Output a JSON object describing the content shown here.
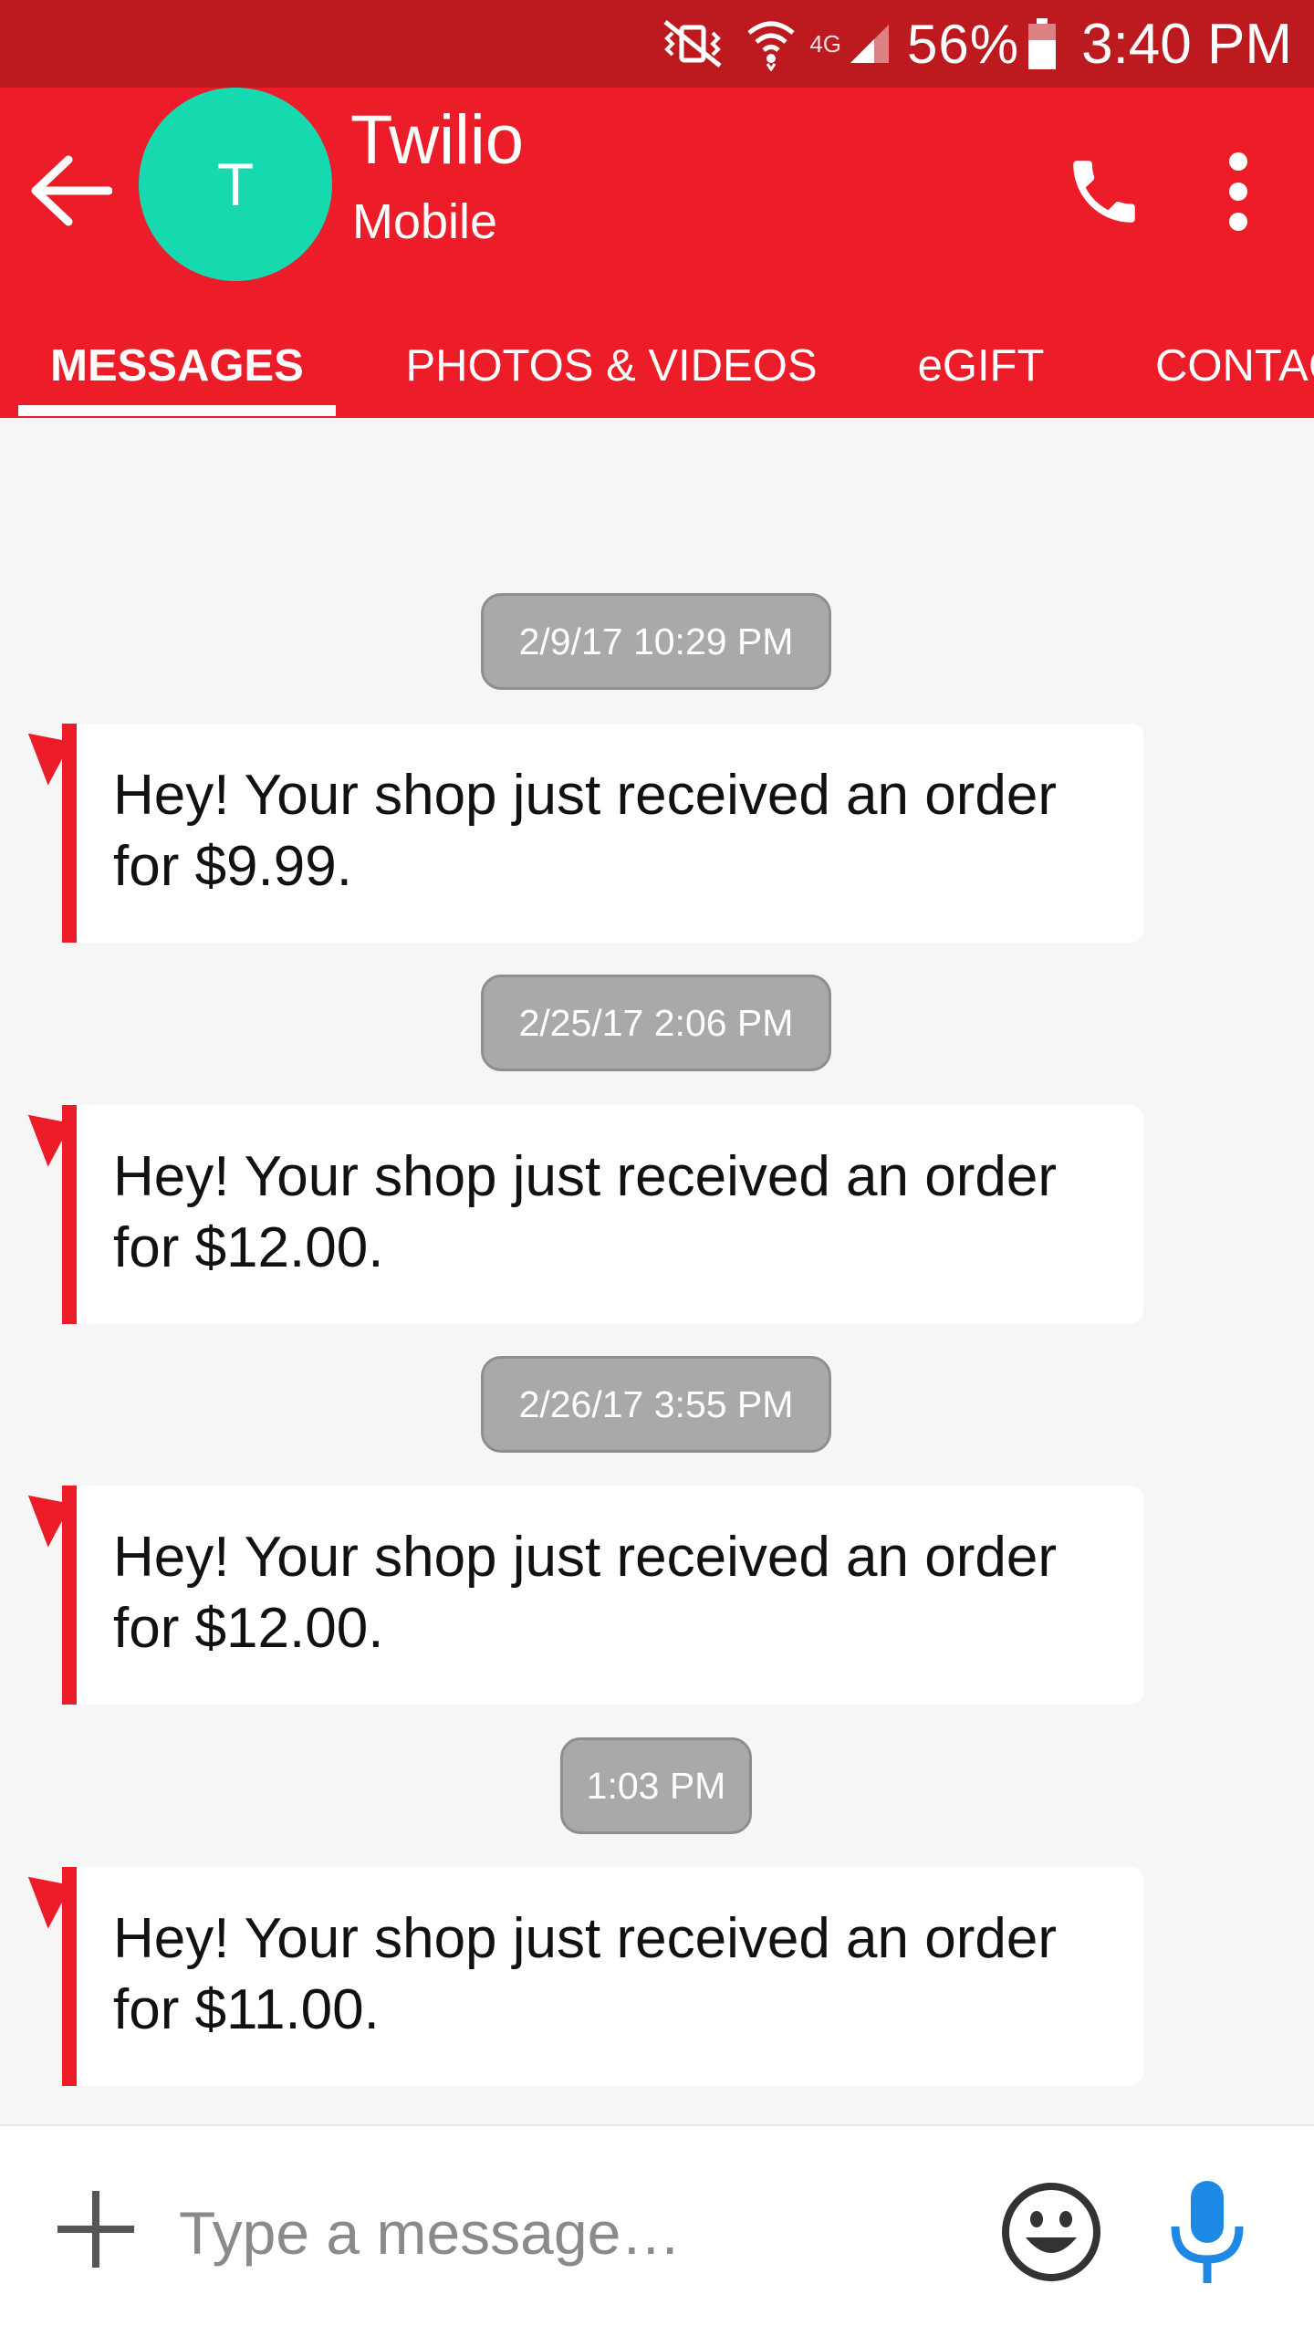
{
  "status_bar": {
    "battery": "56%",
    "time": "3:40 PM",
    "network": "4G",
    "icons": [
      "mute-vibrate-icon",
      "wifi-icon",
      "signal-icon",
      "battery-icon"
    ]
  },
  "header": {
    "avatar_initial": "T",
    "contact_name": "Twilio",
    "contact_type": "Mobile",
    "icons": [
      "back-arrow-icon",
      "phone-icon",
      "more-vert-icon"
    ]
  },
  "tabs": [
    {
      "label": "MESSAGES",
      "active": true
    },
    {
      "label": "PHOTOS & VIDEOS",
      "active": false
    },
    {
      "label": "eGIFT",
      "active": false
    },
    {
      "label": "CONTACTS",
      "active": false
    }
  ],
  "messages": [
    {
      "timestamp": "2/9/17 10:29 PM",
      "text": "Hey! Your shop just received an order for $9.99."
    },
    {
      "timestamp": "2/25/17 2:06 PM",
      "text": "Hey! Your shop just received an order for $12.00."
    },
    {
      "timestamp": "2/26/17 3:55 PM",
      "text": "Hey! Your shop just received an order for $12.00."
    },
    {
      "timestamp": "1:03 PM",
      "text": "Hey! Your shop just received an order for $11.00."
    }
  ],
  "composer": {
    "placeholder": "Type a message…",
    "value": "",
    "icons": [
      "plus-icon",
      "emoji-icon",
      "microphone-icon"
    ]
  },
  "colors": {
    "status_bar": "#bd1a1f",
    "app_bar": "#ed1c29",
    "avatar": "#17d9b0",
    "timestamp_chip": "#a9a9a9",
    "mic": "#1e88e5"
  }
}
